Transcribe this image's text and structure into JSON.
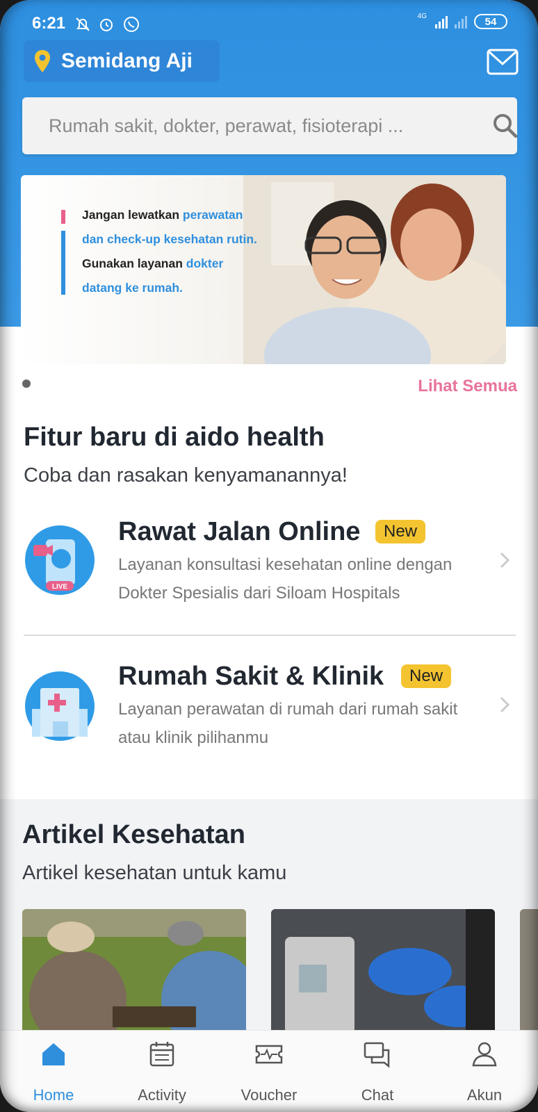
{
  "status_bar": {
    "time": "6:21",
    "network_label": "4G",
    "battery": "54"
  },
  "header": {
    "location": "Semidang Aji",
    "icons": [
      "location-pin-icon",
      "mail-icon"
    ]
  },
  "search": {
    "placeholder": "Rumah sakit, dokter, perawat, fisioterapi ..."
  },
  "banner": {
    "line1_a": "Jangan lewatkan ",
    "line1_b": "perawatan",
    "line2": "dan check-up kesehatan rutin.",
    "line3_a": "Gunakan layanan ",
    "line3_b": "dokter",
    "line4": "datang ke rumah."
  },
  "carousel": {
    "see_all": "Lihat Semua"
  },
  "features": {
    "title": "Fitur baru di aido health",
    "subtitle": "Coba dan rasakan kenyamanannya!",
    "items": [
      {
        "title": "Rawat Jalan Online",
        "badge": "New",
        "description": "Layanan konsultasi kesehatan online dengan Dokter Spesialis dari Siloam Hospitals",
        "icon_label": "LIVE"
      },
      {
        "title": "Rumah Sakit & Klinik",
        "badge": "New",
        "description": "Layanan perawatan di rumah dari rumah sakit atau klinik pilihanmu"
      }
    ]
  },
  "articles": {
    "title": "Artikel Kesehatan",
    "subtitle": "Artikel kesehatan untuk kamu"
  },
  "bottom_nav": [
    {
      "label": "Home",
      "icon": "home-icon",
      "active": true
    },
    {
      "label": "Activity",
      "icon": "calendar-icon",
      "active": false
    },
    {
      "label": "Voucher",
      "icon": "voucher-icon",
      "active": false
    },
    {
      "label": "Chat",
      "icon": "chat-icon",
      "active": false
    },
    {
      "label": "Akun",
      "icon": "account-icon",
      "active": false
    }
  ],
  "colors": {
    "primary_blue": "#2f8fdd",
    "accent_pink": "#e8739b",
    "badge_yellow": "#f4c430"
  }
}
